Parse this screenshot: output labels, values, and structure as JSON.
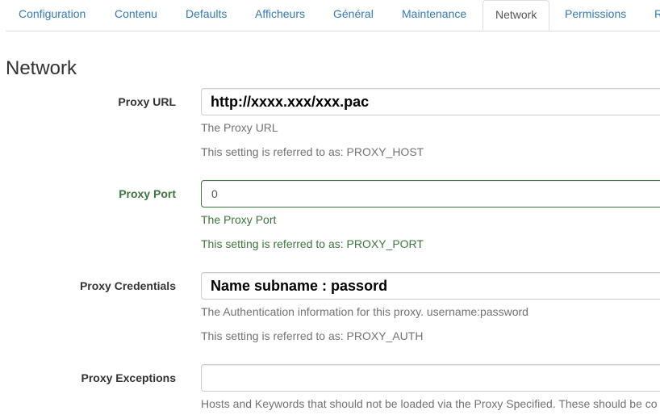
{
  "tabs": [
    {
      "label": "Configuration"
    },
    {
      "label": "Contenu"
    },
    {
      "label": "Defaults"
    },
    {
      "label": "Afficheurs"
    },
    {
      "label": "Général"
    },
    {
      "label": "Maintenance"
    },
    {
      "label": "Network"
    },
    {
      "label": "Permissions"
    },
    {
      "label": "R"
    }
  ],
  "active_tab": "Network",
  "section_title": "Network",
  "fields": [
    {
      "label": "Proxy URL",
      "value": "http://xxxx.xxx/xxx.pac",
      "help": "The Proxy URL",
      "setting": "This setting is referred to as: PROXY_HOST"
    },
    {
      "label": "Proxy Port",
      "value": "0",
      "help": "The Proxy Port",
      "setting": "This setting is referred to as: PROXY_PORT",
      "state": "success"
    },
    {
      "label": "Proxy Credentials",
      "value": "Name subname : passord",
      "help": "The Authentication information for this proxy. username:password",
      "setting": "This setting is referred to as: PROXY_AUTH"
    },
    {
      "label": "Proxy Exceptions",
      "value": "",
      "help": "Hosts and Keywords that should not be loaded via the Proxy Specified. These should be co"
    }
  ],
  "colors": {
    "link": "#337ab7",
    "success": "#3c763d",
    "help_text": "#737373",
    "border": "#dddddd"
  }
}
